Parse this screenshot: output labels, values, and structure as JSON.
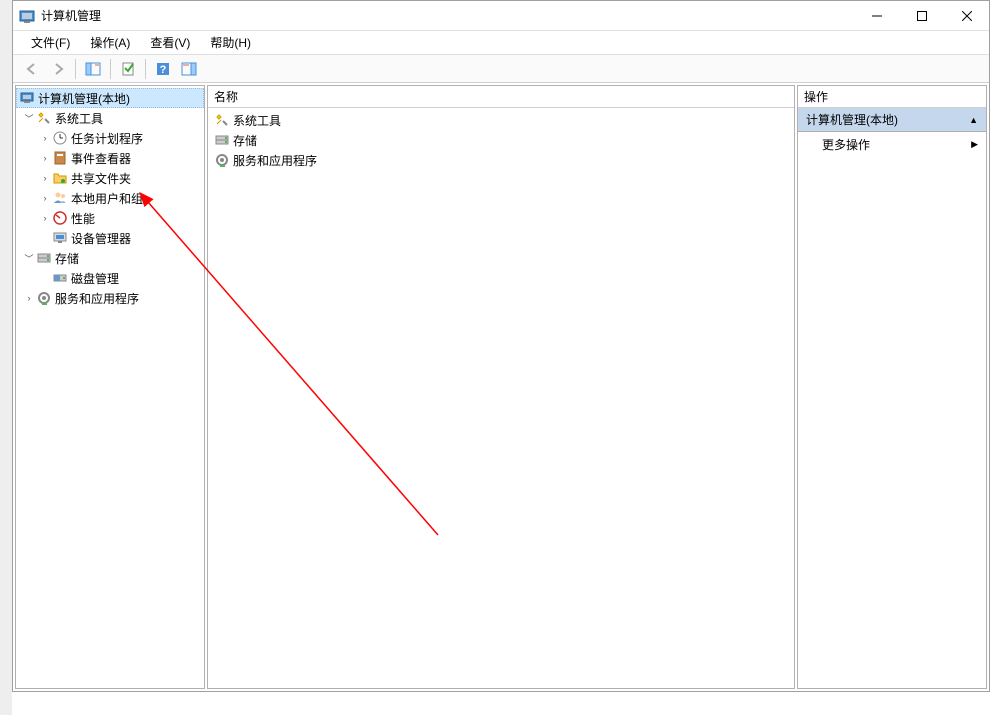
{
  "window": {
    "title": "计算机管理"
  },
  "menu": {
    "file": "文件(F)",
    "action": "操作(A)",
    "view": "查看(V)",
    "help": "帮助(H)"
  },
  "tree": {
    "root": "计算机管理(本地)",
    "system_tools": "系统工具",
    "task_scheduler": "任务计划程序",
    "event_viewer": "事件查看器",
    "shared_folders": "共享文件夹",
    "local_users": "本地用户和组",
    "performance": "性能",
    "device_manager": "设备管理器",
    "storage": "存储",
    "disk_management": "磁盘管理",
    "services_apps": "服务和应用程序"
  },
  "list": {
    "column_name": "名称",
    "items": {
      "system_tools": "系统工具",
      "storage": "存储",
      "services_apps": "服务和应用程序"
    }
  },
  "actions": {
    "header": "操作",
    "section": "计算机管理(本地)",
    "more_actions": "更多操作"
  }
}
